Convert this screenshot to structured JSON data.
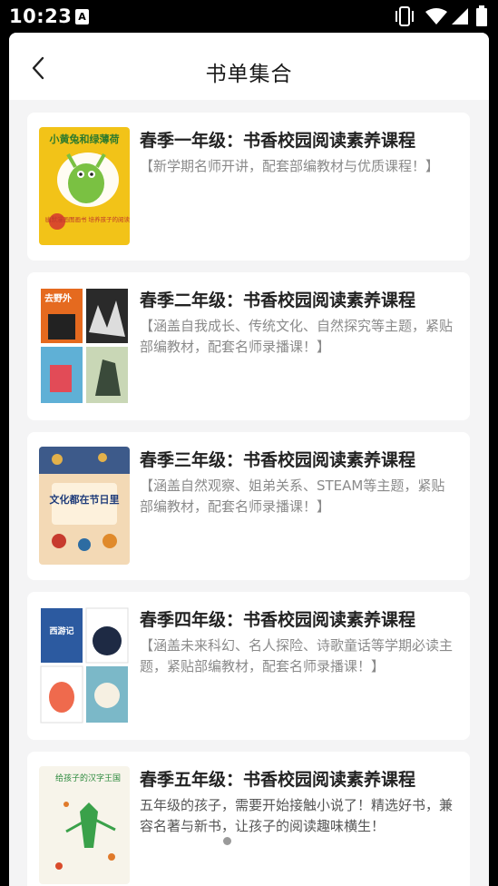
{
  "status_bar": {
    "time": "10:23",
    "notification_icon": "A",
    "icons": [
      "vibrate-icon",
      "wifi-icon",
      "signal-icon",
      "battery-icon"
    ]
  },
  "header": {
    "back_icon": "chevron-left-icon",
    "title": "书单集合"
  },
  "book_lists": [
    {
      "title": "春季一年级：书香校园阅读素养课程",
      "description": "【新学期名师开讲，配套部编教材与优质课程！】",
      "cover_title": "小黄兔和绿薄荷",
      "cover_sub": "幽默漫画图画书 培养孩子的阅读习惯",
      "cover_color": "#f2c318"
    },
    {
      "title": "春季二年级：书香校园阅读素养课程",
      "description": "【涵盖自我成长、传统文化、自然探究等主题，紧贴部编教材，配套名师录播课！】",
      "cover_title": "去野外",
      "cover_color": "#e56a1f"
    },
    {
      "title": "春季三年级：书香校园阅读素养课程",
      "description": "【涵盖自然观察、姐弟关系、STEAM等主题，紧贴部编教材，配套名师录播课！】",
      "cover_title": "文化都在节日里",
      "cover_color": "#f3d9b5"
    },
    {
      "title": "春季四年级：书香校园阅读素养课程",
      "description": "【涵盖未来科幻、名人探险、诗歌童话等学期必读主题，紧贴部编教材，配套名师录播课！】",
      "cover_title": "西游记",
      "cover_color": "#2c5aa0"
    },
    {
      "title": "春季五年级：书香校园阅读素养课程",
      "description": "五年级的孩子，需要开始接触小说了！精选好书，兼容名著与新书，让孩子的阅读趣味横生！",
      "cover_title": "给孩子的汉字王国",
      "cover_color": "#f7f4ea"
    }
  ]
}
